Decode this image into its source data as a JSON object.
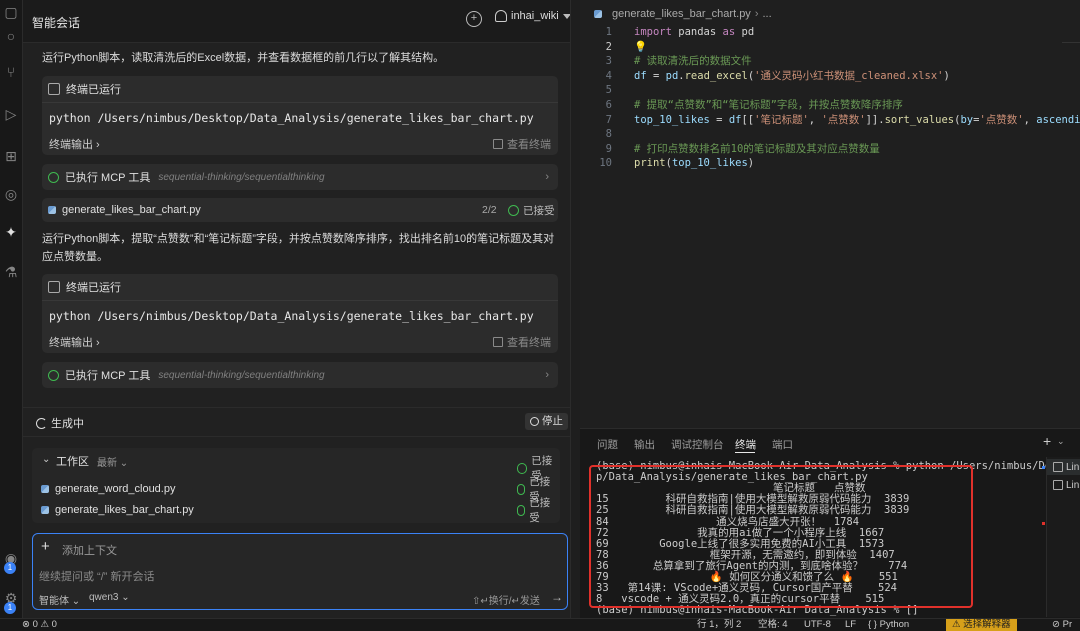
{
  "chat": {
    "title": "智能会话",
    "user": "inhai_wiki",
    "intro_text": "运行Python脚本，读取清洗后的Excel数据，并查看数据框的前几行以了解其结构。",
    "terminal_1": {
      "label": "终端已运行",
      "command": "python /Users/nimbus/Desktop/Data_Analysis/generate_likes_bar_chart.py",
      "output_label": "终端输出",
      "view_label": "查看终端"
    },
    "mcp_1": {
      "label": "已执行 MCP 工具",
      "tool": "sequential-thinking/sequentialthinking"
    },
    "file_card": {
      "name": "generate_likes_bar_chart.py",
      "page": "2/2",
      "status": "已接受"
    },
    "para_2": "运行Python脚本，提取“点赞数”和“笔记标题”字段，并按点赞数降序排序，找出排名前10的笔记标题及其对应点赞数量。",
    "terminal_2": {
      "label": "终端已运行",
      "command": "python /Users/nimbus/Desktop/Data_Analysis/generate_likes_bar_chart.py",
      "output_label": "终端输出",
      "view_label": "查看终端"
    },
    "mcp_2": {
      "label": "已执行 MCP 工具",
      "tool": "sequential-thinking/sequentialthinking"
    },
    "generating_label": "生成中",
    "stop_label": "停止",
    "workspace": {
      "title": "工作区",
      "filter": "最新",
      "status": "已接受",
      "files": [
        {
          "name": "generate_word_cloud.py",
          "status": "已接受"
        },
        {
          "name": "generate_likes_bar_chart.py",
          "status": "已接受"
        }
      ]
    },
    "input": {
      "add_context": "添加上下文",
      "placeholder": "继续提问或 “/” 新开会话",
      "mode": "智能体",
      "model": "qwen3",
      "shortcut": "⇧↵换行/↵发送"
    }
  },
  "editor": {
    "breadcrumb": "generate_likes_bar_chart.py",
    "breadcrumb_more": "...",
    "lines": [
      {
        "n": "1",
        "tokens": [
          {
            "t": "import",
            "c": "kw"
          },
          {
            "t": " pandas ",
            "c": "plain"
          },
          {
            "t": "as",
            "c": "kw"
          },
          {
            "t": " pd",
            "c": "plain"
          }
        ]
      },
      {
        "n": "2",
        "tokens": [
          {
            "t": "💡",
            "c": "plain"
          }
        ]
      },
      {
        "n": "3",
        "tokens": [
          {
            "t": "# 读取清洗后的数据文件",
            "c": "cmt"
          }
        ]
      },
      {
        "n": "4",
        "tokens": [
          {
            "t": "df",
            "c": "var"
          },
          {
            "t": " = ",
            "c": "plain"
          },
          {
            "t": "pd",
            "c": "var"
          },
          {
            "t": ".",
            "c": "plain"
          },
          {
            "t": "read_excel",
            "c": "fn"
          },
          {
            "t": "(",
            "c": "plain"
          },
          {
            "t": "'通义灵码小红书数据_cleaned.xlsx'",
            "c": "str"
          },
          {
            "t": ")",
            "c": "plain"
          }
        ]
      },
      {
        "n": "5",
        "tokens": []
      },
      {
        "n": "6",
        "tokens": [
          {
            "t": "# 提取“点赞数”和“笔记标题”字段，并按点赞数降序排序",
            "c": "cmt"
          }
        ]
      },
      {
        "n": "7",
        "tokens": [
          {
            "t": "top_10_likes",
            "c": "var"
          },
          {
            "t": " = ",
            "c": "plain"
          },
          {
            "t": "df",
            "c": "var"
          },
          {
            "t": "[[",
            "c": "plain"
          },
          {
            "t": "'笔记标题'",
            "c": "str"
          },
          {
            "t": ", ",
            "c": "plain"
          },
          {
            "t": "'点赞数'",
            "c": "str"
          },
          {
            "t": "]].",
            "c": "plain"
          },
          {
            "t": "sort_values",
            "c": "fn"
          },
          {
            "t": "(",
            "c": "plain"
          },
          {
            "t": "by",
            "c": "var"
          },
          {
            "t": "=",
            "c": "plain"
          },
          {
            "t": "'点赞数'",
            "c": "str"
          },
          {
            "t": ", ",
            "c": "plain"
          },
          {
            "t": "ascending",
            "c": "var"
          },
          {
            "t": "=",
            "c": "plain"
          }
        ]
      },
      {
        "n": "8",
        "tokens": []
      },
      {
        "n": "9",
        "tokens": [
          {
            "t": "# 打印点赞数排名前10的笔记标题及其对应点赞数量",
            "c": "cmt"
          }
        ]
      },
      {
        "n": "10",
        "tokens": [
          {
            "t": "print",
            "c": "fn"
          },
          {
            "t": "(",
            "c": "plain"
          },
          {
            "t": "top_10_likes",
            "c": "var"
          },
          {
            "t": ")",
            "c": "plain"
          }
        ]
      }
    ]
  },
  "panel": {
    "tabs": [
      "问题",
      "输出",
      "调试控制台",
      "终端",
      "端口"
    ],
    "active_tab": "终端",
    "terminal_lines": [
      "(base) nimbus@inhais-MacBook-Air Data_Analysis % python /Users/nimbus/Deskto",
      "p/Data_Analysis/generate_likes_bar_chart.py",
      "                            笔记标题   点赞数",
      "15         科研自救指南|使用大模型解救原弱代码能力  3839",
      "25         科研自救指南|使用大模型解救原弱代码能力  3839",
      "84                 通义烧鸟店盛大开张！  1784",
      "72              我真的用ai做了一个小程序上线  1667",
      "69        Google上线了很多实用免费的AI小工具  1573",
      "78                框架开源，无需邀约，即到体验  1407",
      "36       总算拿到了旅行Agent的内测，到底啥体验？    774",
      "79                🔥 如何区分通义和馈了么 🔥    551",
      "33   第14课: VScode+通义灵码, Cursor国产平替    524",
      "8   vscode + 通义灵码2.0，真正的cursor平替    515",
      "(base) nimbus@inhais-MacBook-Air Data_Analysis % []"
    ],
    "term_list": [
      "Lin",
      "Lin"
    ]
  },
  "status": {
    "problems": "⊗ 0 ⚠ 0",
    "position": "行 1，列 2",
    "spaces": "空格: 4",
    "encoding": "UTF-8",
    "eol": "LF",
    "language": "{ } Python",
    "interpreter": "选择解释器",
    "extra": "Pr"
  }
}
